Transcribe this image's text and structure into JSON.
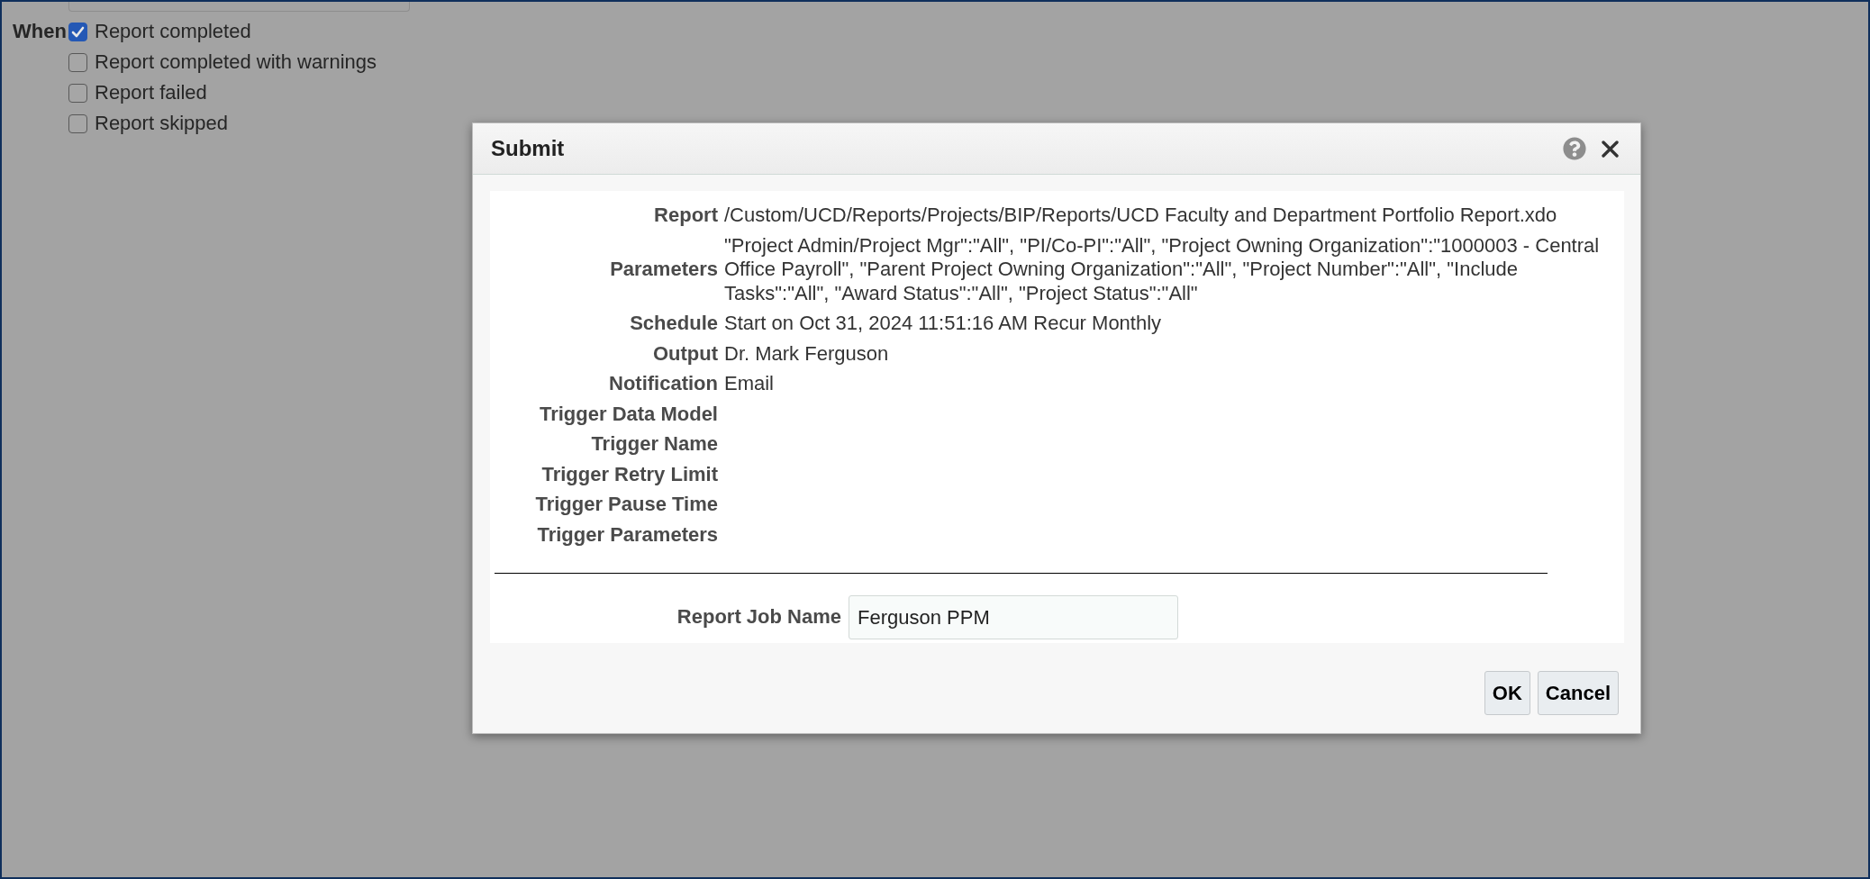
{
  "notify": {
    "label": "When",
    "options": [
      {
        "label": "Report completed",
        "checked": true
      },
      {
        "label": "Report completed with warnings",
        "checked": false
      },
      {
        "label": "Report failed",
        "checked": false
      },
      {
        "label": "Report skipped",
        "checked": false
      }
    ]
  },
  "dialog": {
    "title": "Submit",
    "details": [
      {
        "label": "Report",
        "value": "/Custom/UCD/Reports/Projects/BIP/Reports/UCD Faculty and Department Portfolio Report.xdo"
      },
      {
        "label": "Parameters",
        "value": "\"Project Admin/Project Mgr\":\"All\", \"PI/Co-PI\":\"All\", \"Project Owning Organization\":\"1000003 - Central Office Payroll\", \"Parent Project Owning Organization\":\"All\", \"Project Number\":\"All\", \"Include Tasks\":\"All\", \"Award Status\":\"All\", \"Project Status\":\"All\""
      },
      {
        "label": "Schedule",
        "value": "Start on Oct 31, 2024 11:51:16 AM Recur Monthly"
      },
      {
        "label": "Output",
        "value": "Dr. Mark Ferguson"
      },
      {
        "label": "Notification",
        "value": "Email"
      },
      {
        "label": "Trigger Data Model"
      },
      {
        "label": "Trigger Name"
      },
      {
        "label": "Trigger Retry Limit"
      },
      {
        "label": "Trigger Pause Time"
      },
      {
        "label": "Trigger Parameters"
      }
    ],
    "job_name": {
      "label": "Report Job Name",
      "value": "Ferguson PPM"
    },
    "buttons": [
      "OK",
      "Cancel"
    ]
  }
}
